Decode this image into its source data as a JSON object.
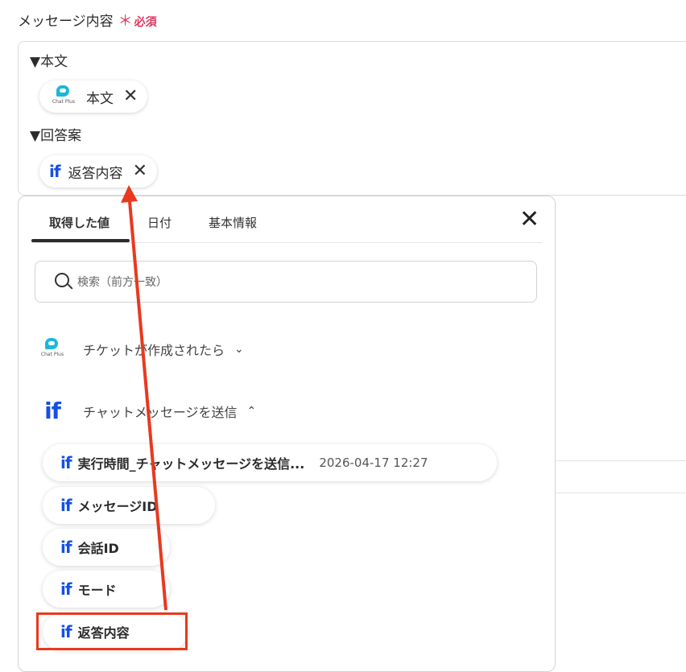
{
  "field": {
    "label": "メッセージ内容",
    "required_mark": "＊",
    "required_text": "必須"
  },
  "editor": {
    "line1": "▼本文",
    "chip1": {
      "icon": "chatplus-logo",
      "label": "本文",
      "logo_caption": "Chat Plus"
    },
    "line2": "▼回答案",
    "chip2": {
      "icon": "if",
      "icon_text": "if",
      "label": "返答内容"
    },
    "remove_glyph": "✕"
  },
  "panel": {
    "tabs": [
      {
        "label": "取得した値",
        "active": true
      },
      {
        "label": "日付",
        "active": false
      },
      {
        "label": "基本情報",
        "active": false
      }
    ],
    "close_glyph": "✕",
    "search": {
      "placeholder": "検索（前方一致）"
    },
    "groups": [
      {
        "icon": "chatplus-logo",
        "logo_caption": "Chat Plus",
        "name": "チケットが作成されたら",
        "expanded": false,
        "chevron": "⌄"
      },
      {
        "icon": "if",
        "icon_text": "if",
        "name": "チャットメッセージを送信",
        "expanded": true,
        "chevron": "⌃"
      }
    ],
    "items": [
      {
        "icon_text": "if",
        "name": "実行時間_チャットメッセージを送信...",
        "value": "2026-04-17 12:27"
      },
      {
        "icon_text": "if",
        "name": "メッセージID",
        "value": ""
      },
      {
        "icon_text": "if",
        "name": "会話ID",
        "value": ""
      },
      {
        "icon_text": "if",
        "name": "モード",
        "value": ""
      },
      {
        "icon_text": "if",
        "name": "返答内容",
        "value": ""
      }
    ]
  },
  "annotation": {
    "highlight_color": "#e8391f"
  },
  "colors": {
    "accent_blue": "#1450e6",
    "required_red": "#e0355f",
    "logo_cyan": "#1db7d8"
  }
}
